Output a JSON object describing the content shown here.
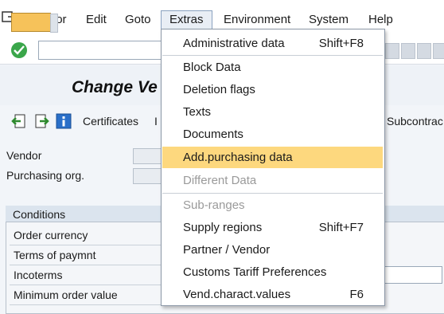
{
  "menubar": {
    "items": [
      "Vendor",
      "Edit",
      "Goto",
      "Extras",
      "Environment",
      "System",
      "Help"
    ]
  },
  "title": {
    "text": "Change Ve"
  },
  "app_toolbar": {
    "certificates": "Certificates",
    "cut_letter": "I",
    "subcontract": "Subcontrac"
  },
  "form": {
    "vendor_label": "Vendor",
    "purch_org_label": "Purchasing org.",
    "conditions_title": "Conditions",
    "rows": [
      "Order currency",
      "Terms of paymnt",
      "Incoterms",
      "Minimum order value"
    ]
  },
  "extras_menu": {
    "items": [
      {
        "label": "Administrative data",
        "shortcut": "Shift+F8"
      },
      {
        "label": "Block Data",
        "shortcut": ""
      },
      {
        "label": "Deletion flags",
        "shortcut": ""
      },
      {
        "label": "Texts",
        "shortcut": ""
      },
      {
        "label": "Documents",
        "shortcut": ""
      },
      {
        "label": "Add.purchasing data",
        "shortcut": ""
      },
      {
        "label": "Different Data",
        "shortcut": ""
      },
      {
        "label": "Sub-ranges",
        "shortcut": ""
      },
      {
        "label": "Supply regions",
        "shortcut": "Shift+F7"
      },
      {
        "label": "Partner / Vendor",
        "shortcut": ""
      },
      {
        "label": "Customs Tariff Preferences",
        "shortcut": ""
      },
      {
        "label": "Vend.charact.values",
        "shortcut": "F6"
      }
    ]
  },
  "colors": {
    "highlight": "#fdd87e",
    "ok_green": "#3aa64a",
    "title_icon": "#f6c25a"
  }
}
